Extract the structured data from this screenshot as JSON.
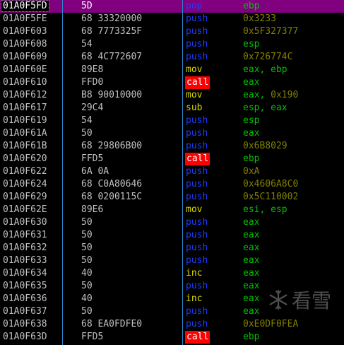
{
  "colors": {
    "push": "#1e3cff",
    "pop": "#1e3cff",
    "mov": "#d7d700",
    "sub": "#d7d700",
    "inc": "#d7d700",
    "call_fg": "#ffffff",
    "call_bg": "#ff0000",
    "reg": "#00c000",
    "imm": "#808000",
    "selected_bg": "#800080"
  },
  "watermark": {
    "text": "看雪",
    "icon": "snowflake-logo-icon"
  },
  "rows": [
    {
      "addr": "01A0F5FD",
      "hex": "5D",
      "mn": "pop",
      "ops": [
        {
          "t": "ebp",
          "k": "reg"
        }
      ]
    },
    {
      "addr": "01A0F5FE",
      "hex": "68 33320000",
      "mn": "push",
      "ops": [
        {
          "t": "0x3233",
          "k": "imm"
        }
      ]
    },
    {
      "addr": "01A0F603",
      "hex": "68 7773325F",
      "mn": "push",
      "ops": [
        {
          "t": "0x5F327377",
          "k": "imm"
        }
      ]
    },
    {
      "addr": "01A0F608",
      "hex": "54",
      "mn": "push",
      "ops": [
        {
          "t": "esp",
          "k": "reg"
        }
      ]
    },
    {
      "addr": "01A0F609",
      "hex": "68 4C772607",
      "mn": "push",
      "ops": [
        {
          "t": "0x726774C",
          "k": "imm"
        }
      ]
    },
    {
      "addr": "01A0F60E",
      "hex": "89E8",
      "mn": "mov",
      "ops": [
        {
          "t": "eax",
          "k": "reg"
        },
        {
          "t": ", ",
          "k": "sep"
        },
        {
          "t": "ebp",
          "k": "reg"
        }
      ]
    },
    {
      "addr": "01A0F610",
      "hex": "FFD0",
      "mn": "call",
      "ops": [
        {
          "t": "eax",
          "k": "reg"
        }
      ]
    },
    {
      "addr": "01A0F612",
      "hex": "B8 90010000",
      "mn": "mov",
      "ops": [
        {
          "t": "eax",
          "k": "reg"
        },
        {
          "t": ", ",
          "k": "sep"
        },
        {
          "t": "0x190",
          "k": "imm"
        }
      ]
    },
    {
      "addr": "01A0F617",
      "hex": "29C4",
      "mn": "sub",
      "ops": [
        {
          "t": "esp",
          "k": "reg"
        },
        {
          "t": ", ",
          "k": "sep"
        },
        {
          "t": "eax",
          "k": "reg"
        }
      ]
    },
    {
      "addr": "01A0F619",
      "hex": "54",
      "mn": "push",
      "ops": [
        {
          "t": "esp",
          "k": "reg"
        }
      ]
    },
    {
      "addr": "01A0F61A",
      "hex": "50",
      "mn": "push",
      "ops": [
        {
          "t": "eax",
          "k": "reg"
        }
      ]
    },
    {
      "addr": "01A0F61B",
      "hex": "68 29806B00",
      "mn": "push",
      "ops": [
        {
          "t": "0x6B8029",
          "k": "imm"
        }
      ]
    },
    {
      "addr": "01A0F620",
      "hex": "FFD5",
      "mn": "call",
      "ops": [
        {
          "t": "ebp",
          "k": "reg"
        }
      ]
    },
    {
      "addr": "01A0F622",
      "hex": "6A 0A",
      "mn": "push",
      "ops": [
        {
          "t": "0xA",
          "k": "imm"
        }
      ]
    },
    {
      "addr": "01A0F624",
      "hex": "68 C0A80646",
      "mn": "push",
      "ops": [
        {
          "t": "0x4606A8C0",
          "k": "imm"
        }
      ]
    },
    {
      "addr": "01A0F629",
      "hex": "68 0200115C",
      "mn": "push",
      "ops": [
        {
          "t": "0x5C110002",
          "k": "imm"
        }
      ]
    },
    {
      "addr": "01A0F62E",
      "hex": "89E6",
      "mn": "mov",
      "ops": [
        {
          "t": "esi",
          "k": "reg"
        },
        {
          "t": ", ",
          "k": "sep"
        },
        {
          "t": "esp",
          "k": "reg"
        }
      ]
    },
    {
      "addr": "01A0F630",
      "hex": "50",
      "mn": "push",
      "ops": [
        {
          "t": "eax",
          "k": "reg"
        }
      ]
    },
    {
      "addr": "01A0F631",
      "hex": "50",
      "mn": "push",
      "ops": [
        {
          "t": "eax",
          "k": "reg"
        }
      ]
    },
    {
      "addr": "01A0F632",
      "hex": "50",
      "mn": "push",
      "ops": [
        {
          "t": "eax",
          "k": "reg"
        }
      ]
    },
    {
      "addr": "01A0F633",
      "hex": "50",
      "mn": "push",
      "ops": [
        {
          "t": "eax",
          "k": "reg"
        }
      ]
    },
    {
      "addr": "01A0F634",
      "hex": "40",
      "mn": "inc",
      "ops": [
        {
          "t": "eax",
          "k": "reg"
        }
      ]
    },
    {
      "addr": "01A0F635",
      "hex": "50",
      "mn": "push",
      "ops": [
        {
          "t": "eax",
          "k": "reg"
        }
      ]
    },
    {
      "addr": "01A0F636",
      "hex": "40",
      "mn": "inc",
      "ops": [
        {
          "t": "eax",
          "k": "reg"
        }
      ]
    },
    {
      "addr": "01A0F637",
      "hex": "50",
      "mn": "push",
      "ops": [
        {
          "t": "eax",
          "k": "reg"
        }
      ]
    },
    {
      "addr": "01A0F638",
      "hex": "68 EA0FDFE0",
      "mn": "push",
      "ops": [
        {
          "t": "0xE0DF0FEA",
          "k": "imm"
        }
      ]
    },
    {
      "addr": "01A0F63D",
      "hex": "FFD5",
      "mn": "call",
      "ops": [
        {
          "t": "ebp",
          "k": "reg"
        }
      ]
    }
  ]
}
